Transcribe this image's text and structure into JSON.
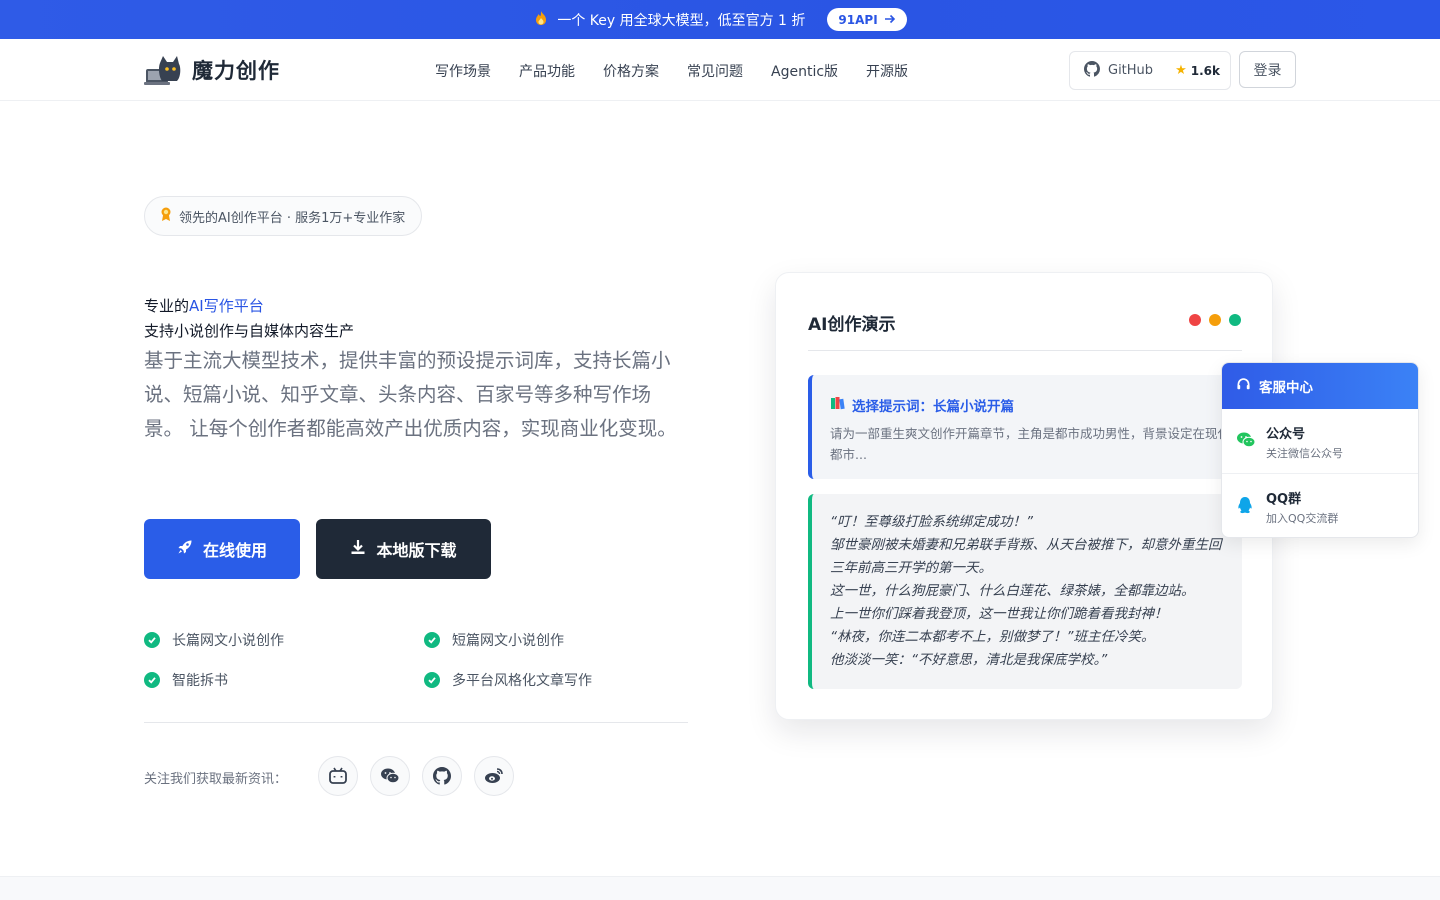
{
  "promo": {
    "text": "一个 Key 用全球大模型，低至官方 1 折",
    "cta": "91API",
    "icon": "fire-icon"
  },
  "nav": {
    "brand": "魔力创作",
    "menu": [
      "写作场景",
      "产品功能",
      "价格方案",
      "常见问题",
      "Agentic版",
      "开源版"
    ],
    "github_label": "GitHub",
    "github_stars": "1.6k",
    "login": "登录"
  },
  "hero": {
    "badge": "领先的AI创作平台 · 服务1万+专业作家",
    "title_prefix": "专业的",
    "title_highlight": "AI写作平台",
    "subtitle": "支持小说创作与自媒体内容生产",
    "description": "基于主流大模型技术，提供丰富的预设提示词库，支持长篇小说、短篇小说、知乎文章、头条内容、百家号等多种写作场景。 让每个创作者都能高效产出优质内容，实现商业化变现。",
    "primary_button": "在线使用",
    "secondary_button": "本地版下载",
    "features": [
      "长篇网文小说创作",
      "短篇网文小说创作",
      "智能拆书",
      "多平台风格化文章写作"
    ],
    "follow_label": "关注我们获取最新资讯：",
    "social_icons": [
      "bilibili-icon",
      "wechat-icon",
      "github-icon",
      "weibo-icon"
    ]
  },
  "demo": {
    "title": "AI创作演示",
    "window_dots": [
      "#ef4444",
      "#f59e0b",
      "#10b981"
    ],
    "prompt_title": "选择提示词：长篇小说开篇",
    "prompt_text": "请为一部重生爽文创作开篇章节，主角是都市成功男性，背景设定在现代都市...",
    "output_lines": [
      "“叮！至尊级打脸系统绑定成功！”",
      "邹世豪刚被未婚妻和兄弟联手背叛、从天台被推下，却意外重生回三年前高三开学的第一天。",
      "这一世，什么狗屁豪门、什么白莲花、绿茶婊，全都靠边站。",
      "上一世你们踩着我登顶，这一世我让你们跪着看我封神！",
      "“林夜，你连二本都考不上，别做梦了！”班主任冷笑。",
      "他淡淡一笑：“不好意思，清北是我保底学校。”"
    ]
  },
  "service": {
    "title": "客服中心",
    "items": [
      {
        "title": "公众号",
        "subtitle": "关注微信公众号",
        "icon": "wechat-icon"
      },
      {
        "title": "QQ群",
        "subtitle": "加入QQ交流群",
        "icon": "qq-icon"
      }
    ]
  },
  "colors": {
    "accent": "#2a5de8",
    "dark_button": "#1f2937",
    "success": "#10b981"
  }
}
